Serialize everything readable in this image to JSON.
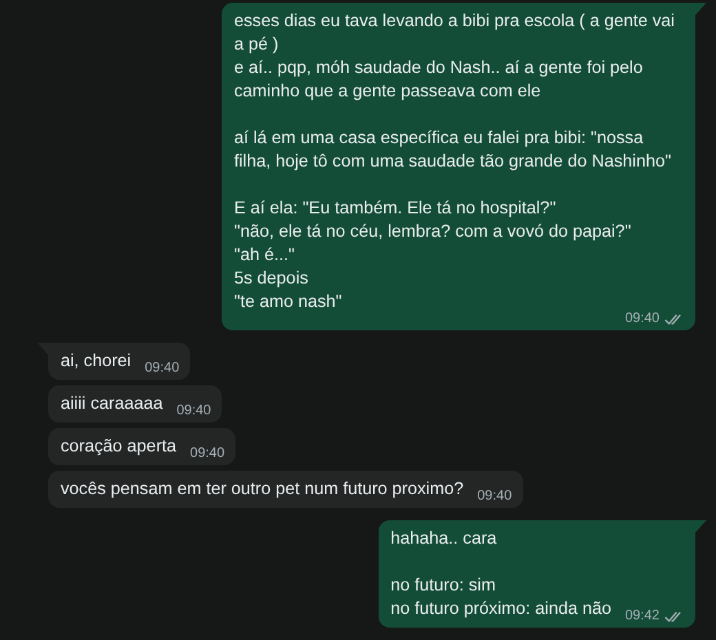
{
  "messages": [
    {
      "kind": "outgoing",
      "tail": true,
      "text": "esses dias eu tava levando a bibi pra escola ( a gente vai a pé )\ne aí.. pqp, móh saudade do Nash.. aí a gente foi pelo caminho que a gente passeava com ele\n\naí lá em uma casa específica eu falei pra bibi: \"nossa filha, hoje tô com uma saudade tão grande do Nashinho\"\n\nE aí ela: \"Eu também. Ele tá no hospital?\"\n\"não, ele tá no céu, lembra? com a vovó do papai?\"\n\"ah é...\"\n5s depois\n\"te amo nash\"",
      "time": "09:40",
      "read": false
    },
    {
      "kind": "incoming",
      "tail": true,
      "text": "ai, chorei",
      "time": "09:40"
    },
    {
      "kind": "incoming",
      "tail": false,
      "text": "aiiii caraaaaa",
      "time": "09:40"
    },
    {
      "kind": "incoming",
      "tail": false,
      "text": "coração aperta",
      "time": "09:40"
    },
    {
      "kind": "incoming",
      "tail": false,
      "text": "vocês pensam em ter outro pet num futuro proximo?",
      "time": "09:40"
    },
    {
      "kind": "outgoing",
      "tail": true,
      "text": "hahaha.. cara\n\nno futuro: sim\nno futuro próximo: ainda não",
      "time": "09:42",
      "read": false
    }
  ]
}
